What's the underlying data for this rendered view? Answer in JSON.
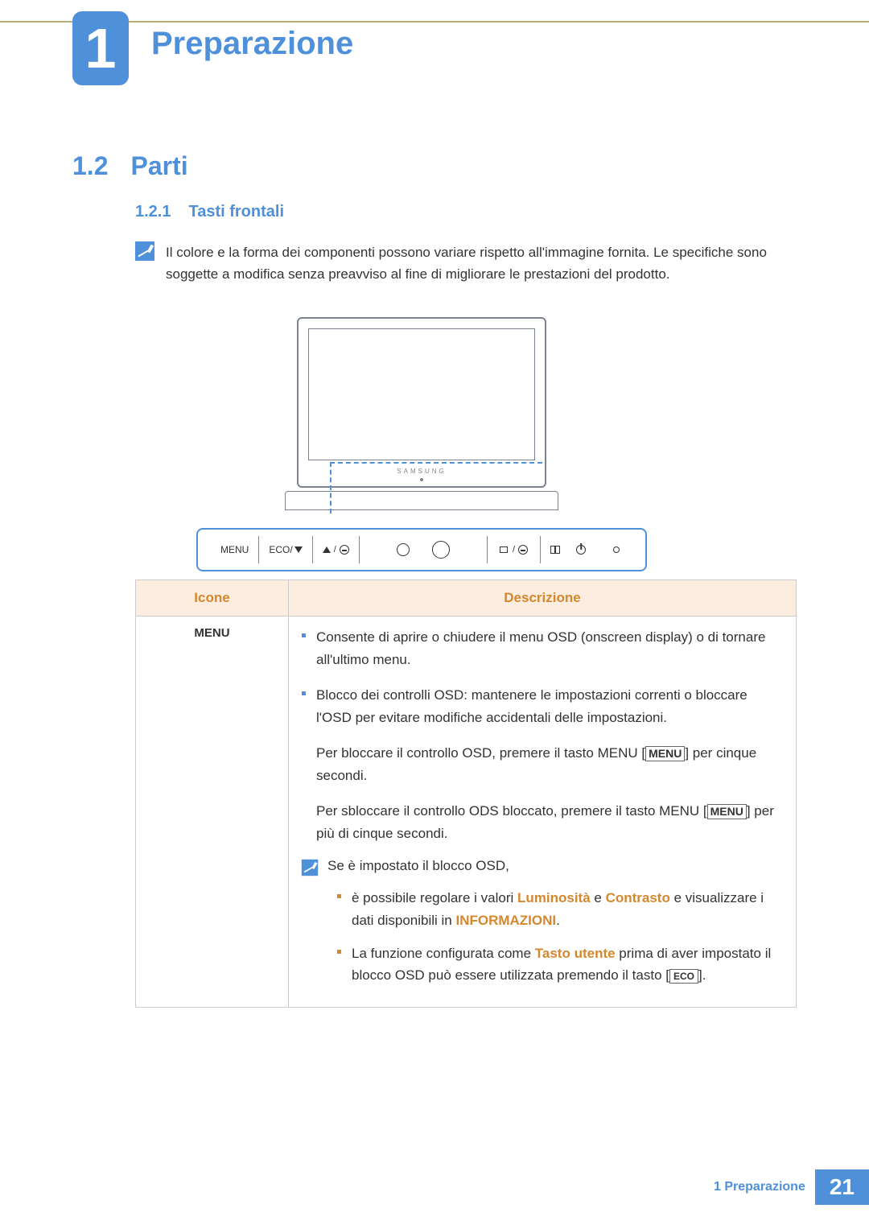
{
  "chapter": {
    "number": "1",
    "title": "Preparazione"
  },
  "section": {
    "number": "1.2",
    "title": "Parti"
  },
  "subsection": {
    "number": "1.2.1",
    "title": "Tasti frontali"
  },
  "note_top": "Il colore e la forma dei componenti possono variare rispetto all'immagine fornita. Le specifiche sono soggette a modifica senza preavviso al fine di migliorare le prestazioni del prodotto.",
  "diagram": {
    "brand": "SAMSUNG",
    "button_bar": {
      "menu": "MENU",
      "eco": "ECO/"
    }
  },
  "table": {
    "headers": {
      "icons": "Icone",
      "desc": "Descrizione"
    },
    "row1": {
      "icon_label": "MENU",
      "bullet1": "Consente di aprire o chiudere il menu OSD (onscreen display) o di tornare all'ultimo menu.",
      "bullet2": "Blocco dei controlli OSD: mantenere le impostazioni correnti o bloccare l'OSD per evitare modifiche accidentali delle impostazioni.",
      "p1_a": "Per bloccare il controllo OSD, premere il tasto MENU [",
      "p1_b": "] per cinque secondi.",
      "p2_a": "Per sbloccare il controllo ODS bloccato, premere il tasto MENU [",
      "p2_b": "] per più di cinque secondi.",
      "menu_label": "MENU",
      "subnote_intro": "Se è impostato il blocco OSD,",
      "sub1_a": "è possibile regolare i valori ",
      "sub1_lum": "Luminosità",
      "sub1_e": " e ",
      "sub1_con": "Contrasto",
      "sub1_b": " e visualizzare i dati disponibili in ",
      "sub1_info": "INFORMAZIONI",
      "sub1_end": ".",
      "sub2_a": "La funzione configurata come ",
      "sub2_tu": "Tasto utente",
      "sub2_b": " prima di aver impostato il blocco OSD può essere utilizzata premendo il tasto [",
      "sub2_eco": "ECO",
      "sub2_end": "]."
    }
  },
  "footer": {
    "chapter_label": "1 Preparazione",
    "page": "21"
  }
}
